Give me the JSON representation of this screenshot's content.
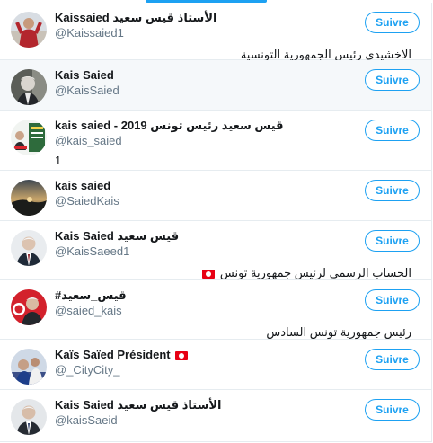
{
  "follow_label": "Suivre",
  "accent_color": "#1da1f2",
  "users": [
    {
      "name": "Kaissaied الأستاذ قيس سعيد",
      "handle": "@Kaissaied1",
      "bio": "الاخشيدي رئيس الجمهورية التونسية",
      "avatar": "avatar-photo-red-jacket"
    },
    {
      "name": "Kais Saied",
      "handle": "@KaisSaied",
      "bio": "",
      "avatar": "avatar-photo-portrait"
    },
    {
      "name": "kais saied - 2019 قيس سعيد رئيس تونس",
      "handle": "@kais_saied",
      "bio": "1",
      "avatar": "avatar-campaign-poster"
    },
    {
      "name": "kais saied",
      "handle": "@SaiedKais",
      "bio": "",
      "avatar": "avatar-sunset-landscape"
    },
    {
      "name": "Kais Saied قيس سعيد",
      "handle": "@KaisSaeed1",
      "bio": "الحساب الرسمي لرئيس جمهورية تونس",
      "avatar": "avatar-photo-portrait"
    },
    {
      "name": "#قيس_سعيد",
      "handle": "@saied_kais",
      "bio": "رئيس جمهورية تونس السادس",
      "avatar": "avatar-flag-portrait"
    },
    {
      "name": "Kaïs Saïed Président",
      "handle": "@_CityCity_",
      "bio": "",
      "avatar": "avatar-crowd-photo"
    },
    {
      "name": "Kais Saied الأستاذ قيس سعيد",
      "handle": "@kaisSaeid",
      "bio": "",
      "avatar": "avatar-photo-portrait"
    }
  ]
}
